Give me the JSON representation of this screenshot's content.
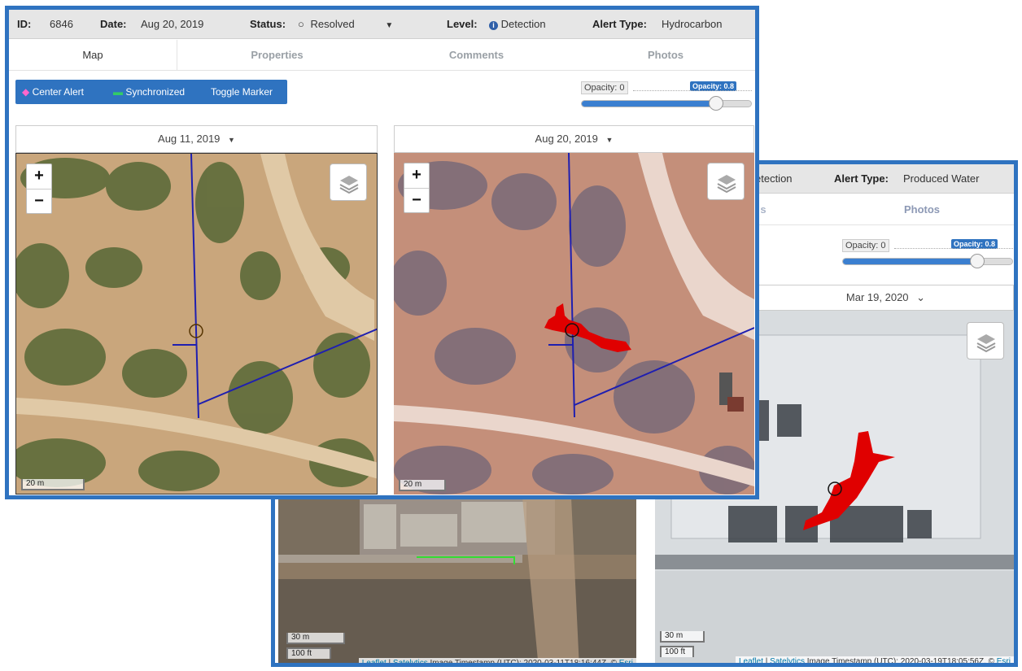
{
  "back": {
    "header": {
      "level_fragment": "etection",
      "alert_type_label": "Alert Type:",
      "alert_type_value": "Produced Water"
    },
    "tabs": {
      "partial": "s",
      "photos": "Photos"
    },
    "opacity": {
      "min_label": "Opacity: 0",
      "badge": "Opacity: 0.8",
      "value": 0.8
    },
    "right_map": {
      "date": "Mar 19, 2020",
      "scale_m": "30 m",
      "scale_ft": "100 ft"
    },
    "left_map": {
      "scale_m": "30 m",
      "scale_ft": "100 ft"
    },
    "attribution_left": {
      "leaflet": "Leaflet",
      "satelytics": "Satelytics",
      "text": " Image Timestamp (UTC): 2020-03-11T18:16:44Z, © ",
      "esri": "Esri"
    },
    "attribution_right": {
      "leaflet": "Leaflet",
      "satelytics": "Satelytics",
      "text": " Image Timestamp (UTC): 2020-03-19T18:05:56Z, © ",
      "esri": "Esri"
    }
  },
  "front": {
    "header": {
      "id_label": "ID:",
      "id_value": "6846",
      "date_label": "Date:",
      "date_value": "Aug 20, 2019",
      "status_label": "Status:",
      "status_value": "Resolved",
      "level_label": "Level:",
      "level_value": "Detection",
      "alert_type_label": "Alert Type:",
      "alert_type_value": "Hydrocarbon"
    },
    "tabs": [
      "Map",
      "Properties",
      "Comments",
      "Photos"
    ],
    "toolbar": {
      "center": "Center Alert",
      "sync": "Synchronized",
      "toggle": "Toggle Marker"
    },
    "opacity": {
      "min_label": "Opacity: 0",
      "badge": "Opacity: 0.8",
      "value": 0.8
    },
    "left_map": {
      "date": "Aug 11, 2019",
      "scale": "20 m"
    },
    "right_map": {
      "date": "Aug 20, 2019",
      "scale": "20 m"
    },
    "zoom": {
      "in": "+",
      "out": "−"
    }
  },
  "icons": [
    "layers-icon",
    "zoom-in-icon",
    "zoom-out-icon",
    "chevron-down-icon",
    "info-icon",
    "radio-icon"
  ],
  "colors": {
    "accent": "#2f73c0",
    "plume": "#e00000",
    "pipeline": "#1f1fb0"
  }
}
